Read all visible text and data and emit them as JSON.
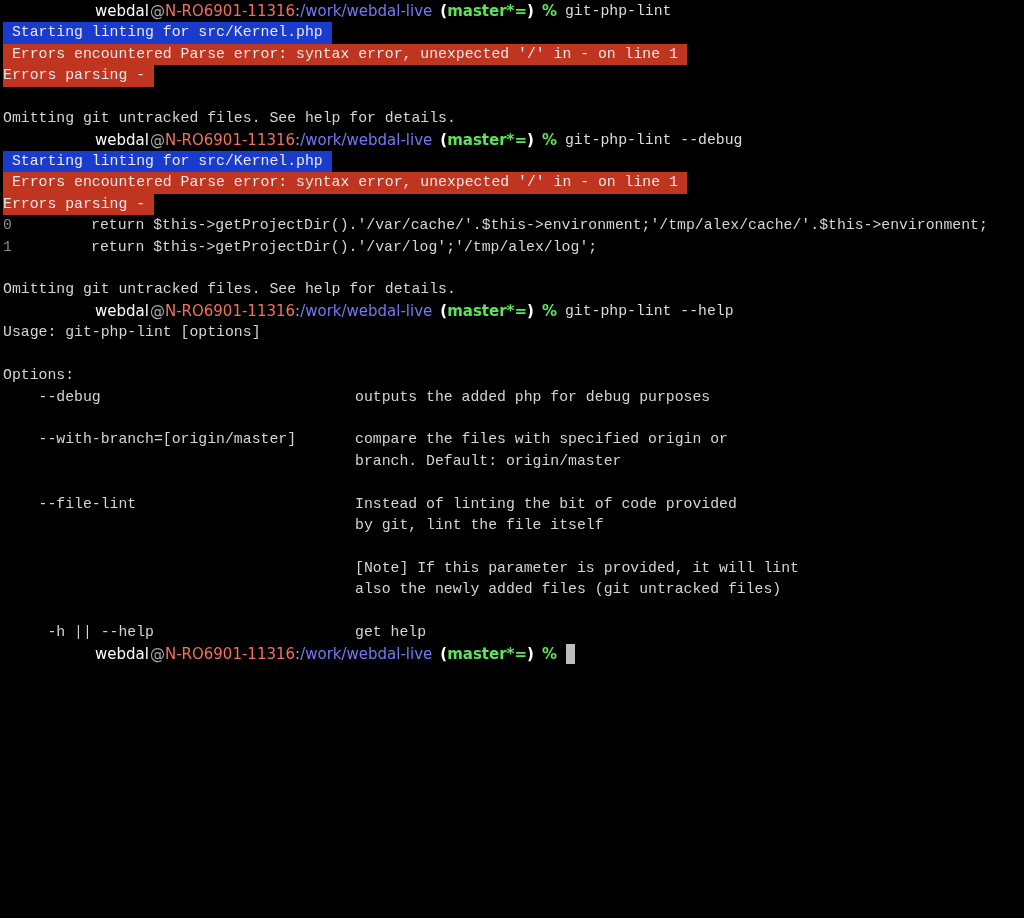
{
  "terminal": {
    "lines": [
      {
        "kind": "prompt",
        "segments": [
          {
            "kind": "user",
            "text": "webdal"
          },
          {
            "kind": "sep",
            "text": "@"
          },
          {
            "kind": "host",
            "text": "N-RO6901-11316"
          },
          {
            "kind": "sep",
            "text": ":"
          },
          {
            "kind": "path",
            "text": "/work/webdal-live"
          },
          {
            "kind": "paren",
            "text": "("
          },
          {
            "kind": "branch",
            "text": "master*="
          },
          {
            "kind": "paren",
            "text": ")"
          },
          {
            "kind": "symbol",
            "text": "%"
          }
        ],
        "command": "git-php-lint",
        "cursor": false
      },
      {
        "kind": "highlight",
        "text": " Starting linting for src/Kernel.php",
        "color": "#1a3ccc"
      },
      {
        "kind": "highlight",
        "text": " Errors encountered Parse error: syntax error, unexpected '/' in - on line 1",
        "color": "#bf3520"
      },
      {
        "kind": "highlight",
        "text": "Errors parsing -",
        "color": "#bf3520"
      },
      {
        "kind": "blank"
      },
      {
        "kind": "text",
        "text": "Omitting git untracked files. See help for details."
      },
      {
        "kind": "prompt",
        "segments": [
          {
            "kind": "user",
            "text": "webdal"
          },
          {
            "kind": "sep",
            "text": "@"
          },
          {
            "kind": "host",
            "text": "N-RO6901-11316"
          },
          {
            "kind": "sep",
            "text": ":"
          },
          {
            "kind": "path",
            "text": "/work/webdal-live"
          },
          {
            "kind": "paren",
            "text": "("
          },
          {
            "kind": "branch",
            "text": "master*="
          },
          {
            "kind": "paren",
            "text": ")"
          },
          {
            "kind": "symbol",
            "text": "%"
          }
        ],
        "command": "git-php-lint --debug",
        "cursor": false
      },
      {
        "kind": "highlight",
        "text": " Starting linting for src/Kernel.php",
        "color": "#1a3ccc"
      },
      {
        "kind": "highlight",
        "text": " Errors encountered Parse error: syntax error, unexpected '/' in - on line 1",
        "color": "#bf3520"
      },
      {
        "kind": "highlight",
        "text": "Errors parsing -",
        "color": "#bf3520"
      },
      {
        "kind": "debug",
        "number": "0",
        "code": "return $this->getProjectDir().'/var/cache/'.$this->environment;'/tmp/alex/cache/'.$this->environment;"
      },
      {
        "kind": "debug",
        "number": "1",
        "code": "return $this->getProjectDir().'/var/log';'/tmp/alex/log';"
      },
      {
        "kind": "blank"
      },
      {
        "kind": "text",
        "text": "Omitting git untracked files. See help for details."
      },
      {
        "kind": "prompt",
        "segments": [
          {
            "kind": "user",
            "text": "webdal"
          },
          {
            "kind": "sep",
            "text": "@"
          },
          {
            "kind": "host",
            "text": "N-RO6901-11316"
          },
          {
            "kind": "sep",
            "text": ":"
          },
          {
            "kind": "path",
            "text": "/work/webdal-live"
          },
          {
            "kind": "paren",
            "text": "("
          },
          {
            "kind": "branch",
            "text": "master*="
          },
          {
            "kind": "paren",
            "text": ")"
          },
          {
            "kind": "symbol",
            "text": "%"
          }
        ],
        "command": "git-php-lint --help",
        "cursor": false
      },
      {
        "kind": "text",
        "text": "Usage: git-php-lint [options]"
      },
      {
        "kind": "blank"
      },
      {
        "kind": "text",
        "text": "Options:"
      },
      {
        "kind": "option",
        "flag": "--debug",
        "paragraphs": [
          [
            "outputs the added php for debug purposes"
          ]
        ]
      },
      {
        "kind": "blank"
      },
      {
        "kind": "option",
        "flag": "--with-branch=[origin/master]",
        "paragraphs": [
          [
            "compare the files with specified origin or",
            "branch. Default: origin/master"
          ]
        ]
      },
      {
        "kind": "blank"
      },
      {
        "kind": "option",
        "flag": "--file-lint",
        "paragraphs": [
          [
            "Instead of linting the bit of code provided",
            "by git, lint the file itself"
          ],
          [
            "[Note] If this parameter is provided, it will lint",
            "also the newly added files (git untracked files)"
          ]
        ]
      },
      {
        "kind": "blank"
      },
      {
        "kind": "option",
        "flag": "-h || --help",
        "short": true,
        "paragraphs": [
          [
            "get help"
          ]
        ]
      },
      {
        "kind": "prompt",
        "segments": [
          {
            "kind": "user",
            "text": "webdal"
          },
          {
            "kind": "sep",
            "text": "@"
          },
          {
            "kind": "host",
            "text": "N-RO6901-11316"
          },
          {
            "kind": "sep",
            "text": ":"
          },
          {
            "kind": "path",
            "text": "/work/webdal-live"
          },
          {
            "kind": "paren",
            "text": "("
          },
          {
            "kind": "branch",
            "text": "master*="
          },
          {
            "kind": "paren",
            "text": ")"
          },
          {
            "kind": "symbol",
            "text": "%"
          }
        ],
        "cursor": true
      }
    ]
  }
}
